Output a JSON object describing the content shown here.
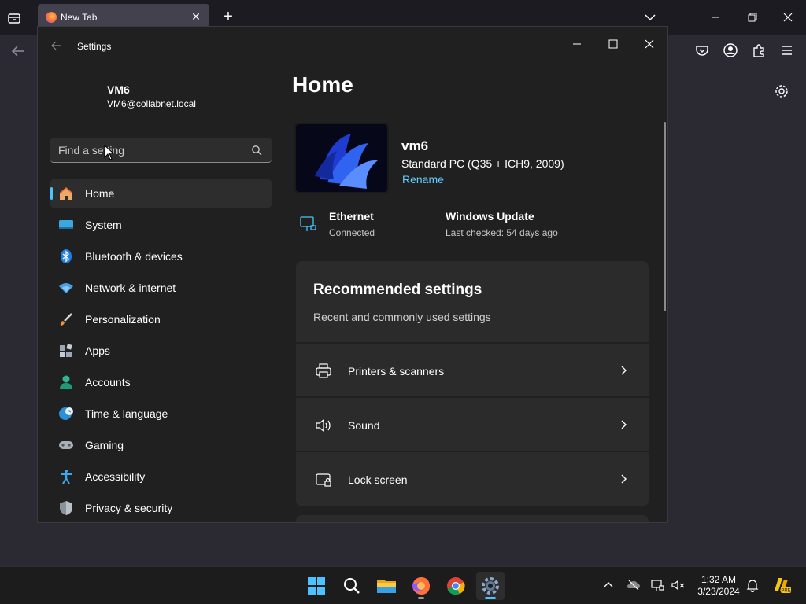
{
  "browser": {
    "tab_title": "New Tab"
  },
  "settings": {
    "window_title": "Settings",
    "profile": {
      "name": "VM6",
      "email": "VM6@collabnet.local"
    },
    "search": {
      "placeholder": "Find a setting"
    },
    "nav": [
      {
        "label": "Home",
        "icon": "home-icon",
        "active": true
      },
      {
        "label": "System",
        "icon": "system-icon"
      },
      {
        "label": "Bluetooth & devices",
        "icon": "bluetooth-icon"
      },
      {
        "label": "Network & internet",
        "icon": "wifi-icon"
      },
      {
        "label": "Personalization",
        "icon": "brush-icon"
      },
      {
        "label": "Apps",
        "icon": "apps-icon"
      },
      {
        "label": "Accounts",
        "icon": "accounts-icon"
      },
      {
        "label": "Time & language",
        "icon": "globe-clock-icon"
      },
      {
        "label": "Gaming",
        "icon": "gamepad-icon"
      },
      {
        "label": "Accessibility",
        "icon": "accessibility-icon"
      },
      {
        "label": "Privacy & security",
        "icon": "shield-icon"
      }
    ],
    "page_title": "Home",
    "device": {
      "name": "vm6",
      "model": "Standard PC (Q35 + ICH9, 2009)",
      "rename_label": "Rename"
    },
    "status": {
      "ethernet": {
        "title": "Ethernet",
        "subtitle": "Connected"
      },
      "update": {
        "title": "Windows Update",
        "subtitle": "Last checked: 54 days ago"
      }
    },
    "recommended": {
      "title": "Recommended settings",
      "subtitle": "Recent and commonly used settings",
      "items": [
        {
          "label": "Printers & scanners",
          "icon": "printer-icon"
        },
        {
          "label": "Sound",
          "icon": "speaker-icon"
        },
        {
          "label": "Lock screen",
          "icon": "lock-screen-icon"
        }
      ]
    }
  },
  "taskbar": {
    "time": "1:32 AM",
    "date": "3/23/2024"
  },
  "colors": {
    "accent": "#4cc2ff",
    "link": "#60cdff",
    "window_bg": "#202020",
    "card_bg": "#2b2b2b"
  }
}
